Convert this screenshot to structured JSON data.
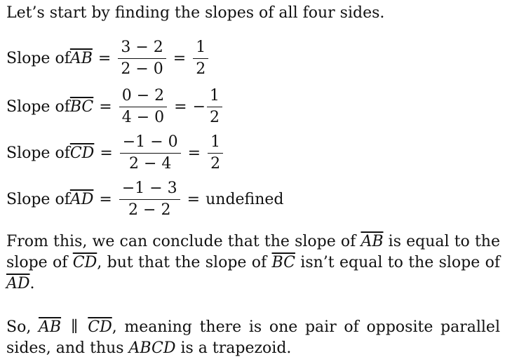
{
  "intro": "Let’s start by finding the slopes of all four sides.",
  "equations": [
    {
      "label": "Slope of ",
      "segment": "AB",
      "num": "3 − 2",
      "den": "2 − 0",
      "sign": "",
      "res_num": "1",
      "res_den": "2",
      "res_text": ""
    },
    {
      "label": "Slope of ",
      "segment": "BC",
      "num": "0 − 2",
      "den": "4 − 0",
      "sign": "−",
      "res_num": "1",
      "res_den": "2",
      "res_text": ""
    },
    {
      "label": "Slope of ",
      "segment": "CD",
      "num": "−1 − 0",
      "den": "2 − 4",
      "sign": "",
      "res_num": "1",
      "res_den": "2",
      "res_text": ""
    },
    {
      "label": "Slope of ",
      "segment": "AD",
      "num": "−1 − 3",
      "den": "2 − 2",
      "sign": "",
      "res_num": "",
      "res_den": "",
      "res_text": "undefined"
    }
  ],
  "equals": "=",
  "conclusion": {
    "t1": "From this, we can conclude that the slope of ",
    "s1": "AB",
    "t2": " is equal to the slope of ",
    "s2": "CD",
    "t3": ", but that the slope of ",
    "s3": "BC",
    "t4": " isn’t equal to the slope of ",
    "s4": "AD",
    "t5": "."
  },
  "final": {
    "t1": "So, ",
    "s1": "AB",
    "parallel": "∥",
    "s2": "CD",
    "t2": ", meaning there is one pair of opposite parallel sides, and thus ",
    "shape": "ABCD",
    "t3": " is a trapezoid."
  }
}
